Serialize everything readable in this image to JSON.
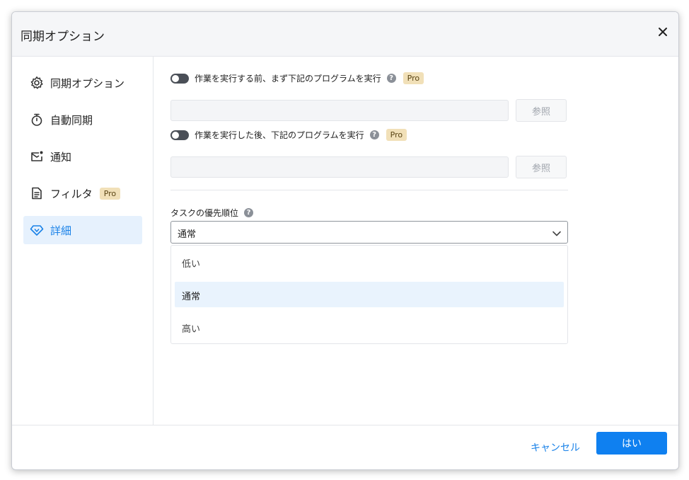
{
  "dialog": {
    "title": "同期オプション",
    "close_icon": "close-icon"
  },
  "sidebar": {
    "items": [
      {
        "label": "同期オプション",
        "icon": "gear-icon"
      },
      {
        "label": "自動同期",
        "icon": "stopwatch-icon"
      },
      {
        "label": "通知",
        "icon": "mail-notification-icon"
      },
      {
        "label": "フィルタ",
        "icon": "document-filter-icon",
        "badge": "Pro"
      },
      {
        "label": "詳細",
        "icon": "diamond-icon",
        "active": true
      }
    ]
  },
  "content": {
    "before_run": {
      "label": "作業を実行する前、まず下記のプログラムを実行",
      "badge": "Pro",
      "value": "",
      "browse_label": "参照",
      "enabled": false
    },
    "after_run": {
      "label": "作業を実行した後、下記のプログラムを実行",
      "badge": "Pro",
      "value": "",
      "browse_label": "参照",
      "enabled": false
    },
    "priority": {
      "label": "タスクの優先順位",
      "selected": "通常",
      "options": [
        "低い",
        "通常",
        "高い"
      ]
    }
  },
  "footer": {
    "cancel_label": "キャンセル",
    "ok_label": "はい"
  },
  "colors": {
    "accent": "#1a82e8",
    "primary_button": "#0f80f0",
    "active_nav_bg": "#e6f1fd",
    "pro_badge": "#f1e0b8"
  }
}
